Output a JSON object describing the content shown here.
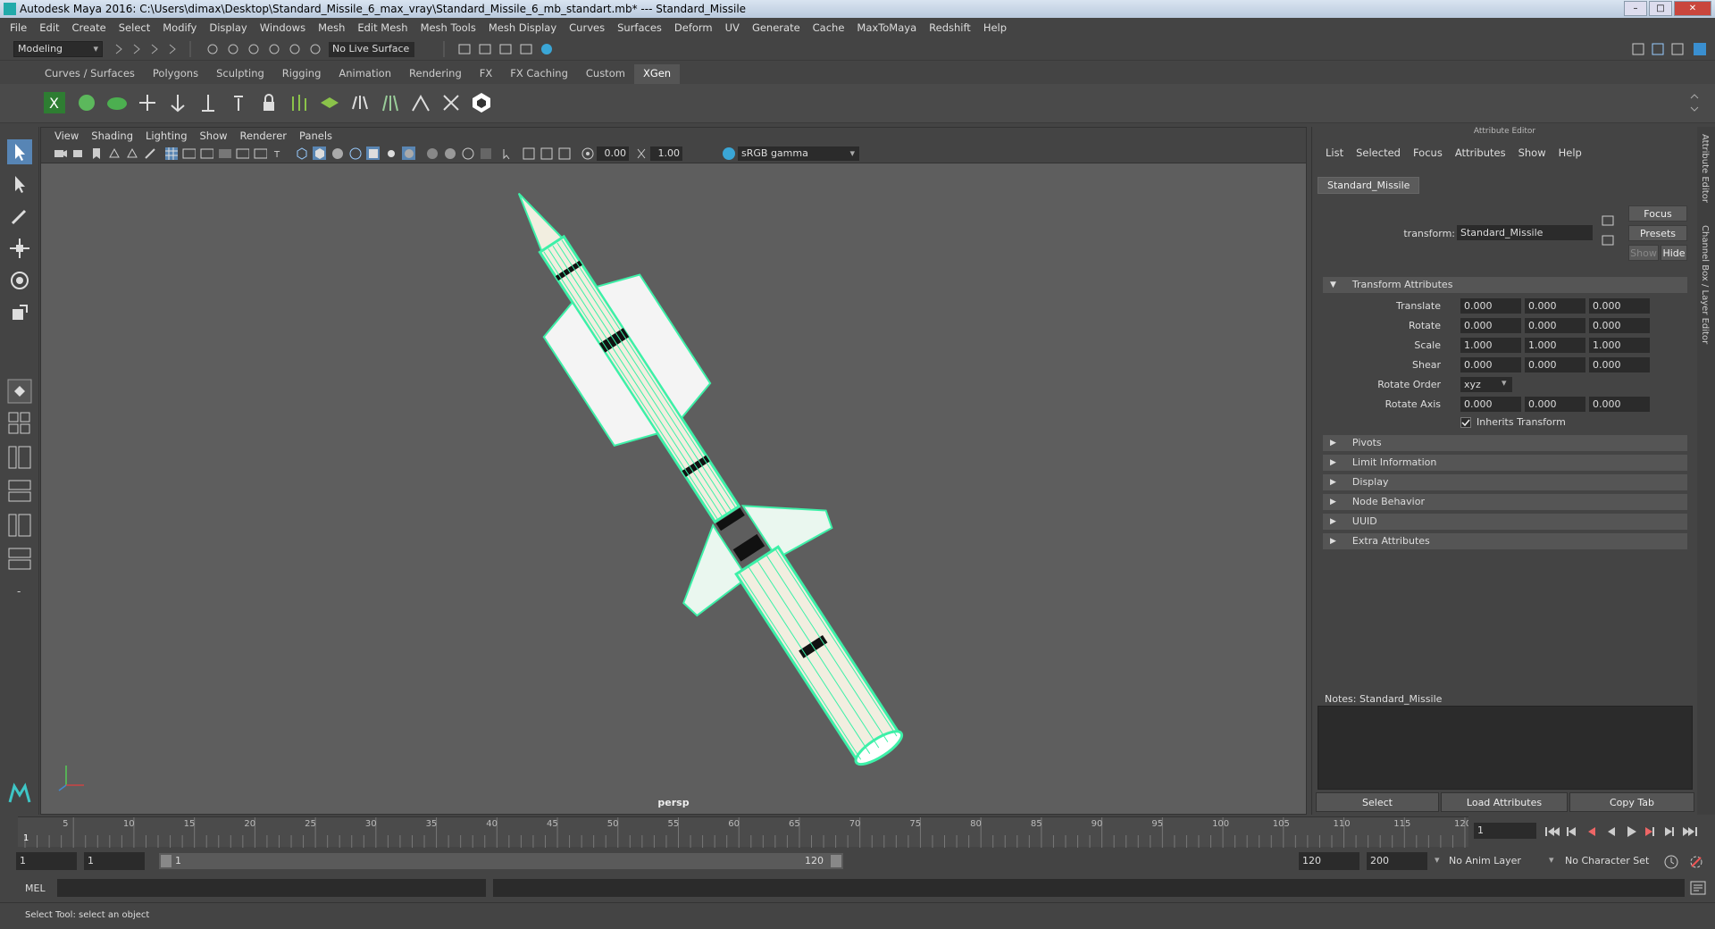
{
  "window": {
    "title": "Autodesk Maya 2016: C:\\Users\\dimax\\Desktop\\Standard_Missile_6_max_vray\\Standard_Missile_6_mb_standart.mb*   ---   Standard_Missile",
    "min": "–",
    "max": "□",
    "close": "✕"
  },
  "menubar": [
    "File",
    "Edit",
    "Create",
    "Select",
    "Modify",
    "Display",
    "Windows",
    "Mesh",
    "Edit Mesh",
    "Mesh Tools",
    "Mesh Display",
    "Curves",
    "Surfaces",
    "Deform",
    "UV",
    "Generate",
    "Cache",
    "MaxToMaya",
    "Redshift",
    "Help"
  ],
  "statusline": {
    "mode": "Modeling",
    "live_surface": "No Live Surface"
  },
  "shelf_tabs": [
    {
      "label": "Curves / Surfaces"
    },
    {
      "label": "Polygons"
    },
    {
      "label": "Sculpting"
    },
    {
      "label": "Rigging"
    },
    {
      "label": "Animation"
    },
    {
      "label": "Rendering"
    },
    {
      "label": "FX"
    },
    {
      "label": "FX Caching"
    },
    {
      "label": "Custom"
    },
    {
      "label": "XGen",
      "active": true
    }
  ],
  "viewport": {
    "menu": [
      "View",
      "Shading",
      "Lighting",
      "Show",
      "Renderer",
      "Panels"
    ],
    "exposure": "0.00",
    "gamma_value": "1.00",
    "color_space": "sRGB gamma",
    "camera": "persp",
    "wire_color": "#3df0a8",
    "mesh_color": "#f2eee0"
  },
  "attribute_editor": {
    "header": "Attribute Editor",
    "menu": [
      "List",
      "Selected",
      "Focus",
      "Attributes",
      "Show",
      "Help"
    ],
    "node_tab": "Standard_Missile",
    "transform_label": "transform:",
    "transform_value": "Standard_Missile",
    "focus_btn": "Focus",
    "presets_btn": "Presets",
    "show_btn": "Show",
    "hide_btn": "Hide",
    "section_transform": "Transform Attributes",
    "rows": [
      {
        "label": "Translate",
        "values": [
          "0.000",
          "0.000",
          "0.000"
        ]
      },
      {
        "label": "Rotate",
        "values": [
          "0.000",
          "0.000",
          "0.000"
        ]
      },
      {
        "label": "Scale",
        "values": [
          "1.000",
          "1.000",
          "1.000"
        ]
      },
      {
        "label": "Shear",
        "values": [
          "0.000",
          "0.000",
          "0.000"
        ]
      }
    ],
    "rotate_order_label": "Rotate Order",
    "rotate_order_value": "xyz",
    "rotate_axis_label": "Rotate Axis",
    "rotate_axis_values": [
      "0.000",
      "0.000",
      "0.000"
    ],
    "inherits_transform": "Inherits Transform",
    "sections": [
      "Pivots",
      "Limit Information",
      "Display",
      "Node Behavior",
      "UUID",
      "Extra Attributes"
    ],
    "notes_label": "Notes:  Standard_Missile",
    "buttons": {
      "select": "Select",
      "load": "Load Attributes",
      "copy": "Copy Tab"
    },
    "side_tabs": [
      "Attribute Editor",
      "Channel Box / Layer Editor"
    ]
  },
  "timeline": {
    "ticks": [
      "5",
      "10",
      "15",
      "20",
      "25",
      "30",
      "35",
      "40",
      "45",
      "50",
      "55",
      "60",
      "65",
      "70",
      "75",
      "80",
      "85",
      "90",
      "95",
      "100",
      "105",
      "110",
      "115",
      "120"
    ],
    "current_frame_label": "1",
    "current_frame_field": "1"
  },
  "range": {
    "start": "1",
    "playback_start": "1",
    "slider_start": "1",
    "slider_end": "120",
    "playback_end": "120",
    "end": "200",
    "anim_layer": "No Anim Layer",
    "char_set": "No Character Set"
  },
  "cmdline": {
    "label": "MEL"
  },
  "helpline": {
    "text": "Select Tool: select an object"
  }
}
